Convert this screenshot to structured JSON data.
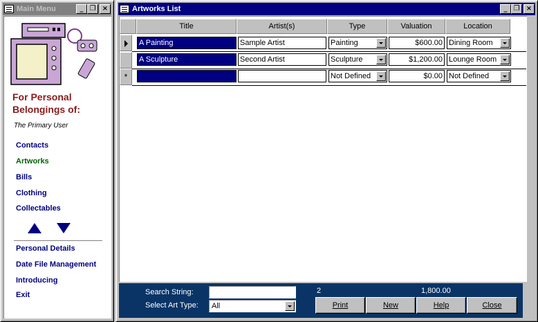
{
  "menu": {
    "title": "Main Menu",
    "heading_line1": "For Personal",
    "heading_line2": "Belongings of:",
    "owner": "The Primary User",
    "items": [
      {
        "label": "Contacts"
      },
      {
        "label": "Artworks"
      },
      {
        "label": "Bills"
      },
      {
        "label": "Clothing"
      },
      {
        "label": "Collectables"
      }
    ],
    "items2": [
      {
        "label": "Personal Details"
      },
      {
        "label": "Date File Management"
      },
      {
        "label": "Introducing"
      },
      {
        "label": "Exit"
      }
    ]
  },
  "artworks": {
    "title": "Artworks List",
    "columns": [
      "Title",
      "Artist(s)",
      "Type",
      "Valuation",
      "Location"
    ],
    "rows": [
      {
        "title": "A Painting",
        "artist": "Sample Artist",
        "type": "Painting",
        "valuation": "$600.00",
        "location": "Dining Room"
      },
      {
        "title": "A Sculpture",
        "artist": "Second Artist",
        "type": "Sculpture",
        "valuation": "$1,200.00",
        "location": "Lounge Room"
      },
      {
        "title": "",
        "artist": "",
        "type": "Not Defined",
        "valuation": "$0.00",
        "location": "Not Defined"
      }
    ],
    "new_row_marker": "*",
    "footer": {
      "search_label": "Search String:",
      "search_value": "",
      "type_label": "Select Art Type:",
      "type_value": "All",
      "count": "2",
      "total": "1,800.00",
      "buttons": {
        "print": "Print",
        "new": "New",
        "help": "Help",
        "close": "Close"
      }
    }
  },
  "window_buttons": {
    "minimize": "_",
    "restore": "❐",
    "close": "×"
  },
  "colors": {
    "titlebar_active": "#000080",
    "footer_bg": "#0a3466",
    "brand_red": "#8b1a1a",
    "nav_blue": "#000080",
    "nav_current": "#006400"
  }
}
